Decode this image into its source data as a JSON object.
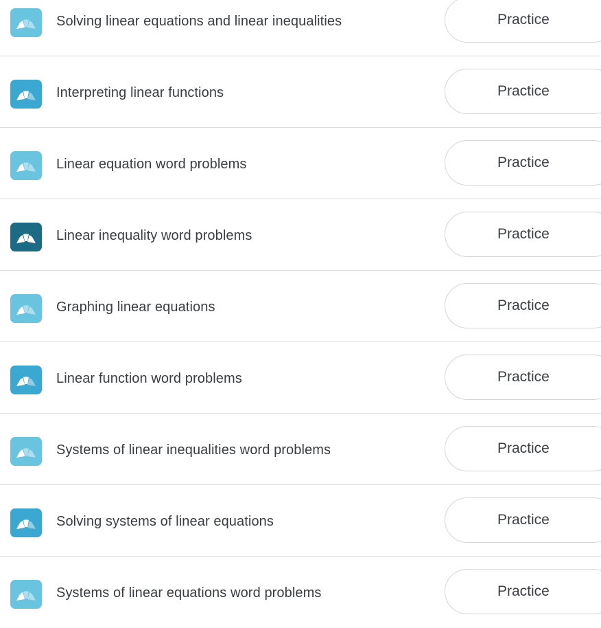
{
  "practice_label": "Practice",
  "colors": {
    "level_light": "#69c4e0",
    "level_medium": "#3aa8d0",
    "level_dark": "#1d6a85",
    "divider": "#dcdcdc"
  },
  "skills": [
    {
      "title": "Solving linear equations and linear inequalities",
      "level": "light"
    },
    {
      "title": "Interpreting linear functions",
      "level": "medium"
    },
    {
      "title": "Linear equation word problems",
      "level": "light"
    },
    {
      "title": "Linear inequality word problems",
      "level": "dark"
    },
    {
      "title": "Graphing linear equations",
      "level": "light"
    },
    {
      "title": "Linear function word problems",
      "level": "medium"
    },
    {
      "title": "Systems of linear inequalities word problems",
      "level": "light"
    },
    {
      "title": "Solving systems of linear equations",
      "level": "medium"
    },
    {
      "title": "Systems of linear equations word problems",
      "level": "light"
    }
  ]
}
